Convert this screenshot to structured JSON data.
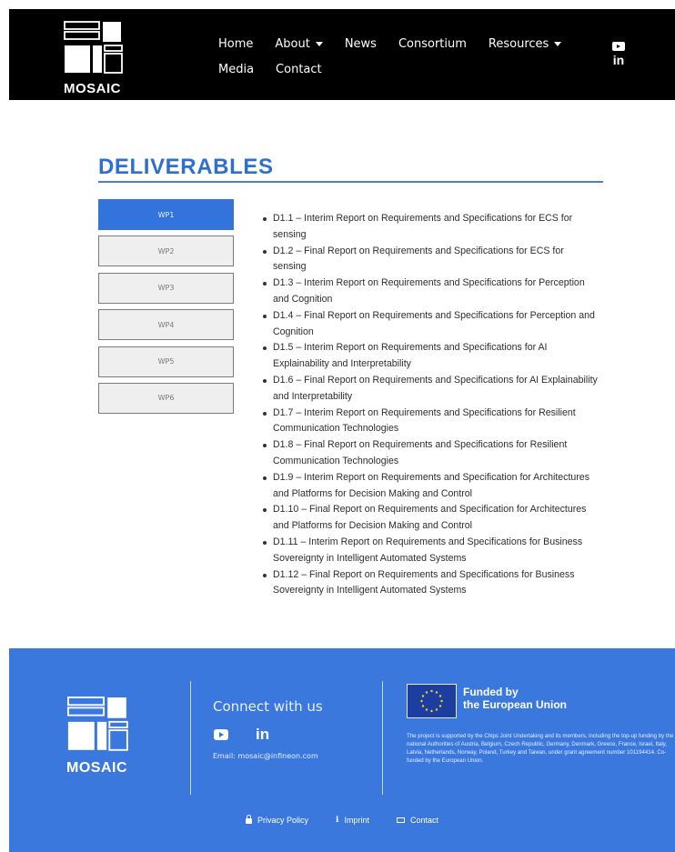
{
  "brand": {
    "name": "MOSAIC"
  },
  "nav": {
    "row1": [
      {
        "label": "Home",
        "has_dropdown": false
      },
      {
        "label": "About",
        "has_dropdown": true
      },
      {
        "label": "News",
        "has_dropdown": false
      },
      {
        "label": "Consortium",
        "has_dropdown": false
      },
      {
        "label": "Resources",
        "has_dropdown": true
      }
    ],
    "row2": [
      {
        "label": "Media",
        "has_dropdown": false
      },
      {
        "label": "Contact",
        "has_dropdown": false
      }
    ],
    "social": [
      "youtube-icon",
      "linkedin-icon"
    ],
    "linkedin_glyph": "in"
  },
  "main": {
    "title": "DELIVERABLES",
    "tabs": [
      {
        "label": "WP1",
        "active": true
      },
      {
        "label": "WP2",
        "active": false
      },
      {
        "label": "WP3",
        "active": false
      },
      {
        "label": "WP4",
        "active": false
      },
      {
        "label": "WP5",
        "active": false
      },
      {
        "label": "WP6",
        "active": false
      }
    ],
    "deliverables": [
      "D1.1 – Interim Report on Requirements and Specifications for ECS for sensing",
      "D1.2 – Final Report on Requirements and Specifications for ECS for sensing",
      "D1.3 – Interim Report on Requirements and Specifications for Perception and Cognition",
      "D1.4 – Final Report on Requirements and Specifications for Perception and Cognition",
      "D1.5 – Interim Report on Requirements and Specifications for AI Explainability and Interpretability",
      "D1.6 – Final Report on Requirements and Specifications for AI Explainability and Interpretability",
      "D1.7 – Interim Report on Requirements and Specifications for Resilient Communication Technologies",
      "D1.8 – Final Report on Requirements and Specifications for Resilient Communication Technologies",
      "D1.9 – Interim Report on Requirements and Specification for Architectures and Platforms for Decision Making and Control",
      "D1.10 – Final Report on Requirements and Specification for Architectures and Platforms for Decision Making and Control",
      "D1.11 – Interim Report on Requirements and Specifications for Business Sovereignty in Intelligent Automated Systems",
      "D1.12 – Final Report on Requirements and Specifications for Business Sovereignty in Intelligent Automated Systems"
    ]
  },
  "footer": {
    "connect_title": "Connect with us",
    "linkedin_glyph": "in",
    "email": "Email: mosaic@infineon.com",
    "eu_funded_line1": "Funded by",
    "eu_funded_line2": "the European Union",
    "eu_text": "The project is supported by the Chips Joint Undertaking and its members, including the top-up funding by the national Authorities of Austria, Belgium, Czech Republic, Germany, Denmark, Greece, France, Israel, Italy, Latvia, Netherlands, Norway, Poland, Turkey and Taiwan, under grant agreement number 101194414. Co-funded by the European Union.",
    "links": [
      {
        "label": "Privacy Policy",
        "icon": "lock-icon"
      },
      {
        "label": "Imprint",
        "icon": "info-icon"
      },
      {
        "label": "Contact",
        "icon": "mail-icon"
      }
    ]
  },
  "colors": {
    "header_bg": "#000000",
    "accent": "#3274dc",
    "title": "#2f6fd0",
    "footer_bg": "#3b78de",
    "tab_inactive_bg": "#efefef"
  }
}
